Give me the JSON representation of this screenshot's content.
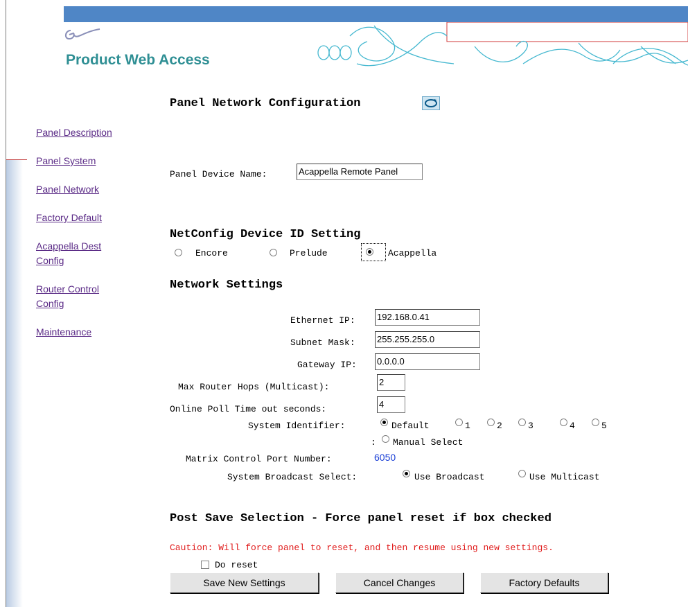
{
  "brand": {
    "title": "Product Web Access"
  },
  "nav": {
    "items": [
      {
        "label": "Panel Description"
      },
      {
        "label": "Panel System"
      },
      {
        "label": "Panel Network"
      },
      {
        "label": "Factory Default"
      },
      {
        "label": "Acappella Dest",
        "label2": "Config"
      },
      {
        "label": "Router Control",
        "label2": "Config"
      },
      {
        "label": "Maintenance"
      }
    ]
  },
  "page": {
    "title": "Panel Network Configuration",
    "device_name_label": "Panel Device Name:",
    "device_name_value": "Acappella Remote Panel"
  },
  "netconfig": {
    "heading": "NetConfig Device ID Setting",
    "options": [
      "Encore",
      "Prelude",
      "Acappella"
    ],
    "selected": "Acappella"
  },
  "network": {
    "heading": "Network Settings",
    "ethernet_ip_label": "Ethernet IP:",
    "ethernet_ip": "192.168.0.41",
    "subnet_label": "Subnet Mask:",
    "subnet": "255.255.255.0",
    "gateway_label": "Gateway IP:",
    "gateway": "0.0.0.0",
    "hops_label": "Max Router Hops (Multicast):",
    "hops": "2",
    "poll_label": "Online Poll Time out seconds:",
    "poll": "4",
    "sysid_label": "System Identifier:",
    "sysid_options": [
      "Default",
      "1",
      "2",
      "3",
      "4",
      "5"
    ],
    "sysid_selected": "Default",
    "manual_prefix": ":",
    "manual_label": "Manual Select",
    "port_label": "Matrix Control Port Number:",
    "port_value": "6050",
    "broadcast_label": "System Broadcast Select:",
    "broadcast_options": [
      "Use Broadcast",
      "Use Multicast"
    ],
    "broadcast_selected": "Use Broadcast"
  },
  "post_save": {
    "heading": "Post Save Selection - Force panel reset if box checked",
    "caution": "Caution: Will force panel to reset, and then resume using new settings.",
    "reset_label": "Do reset"
  },
  "buttons": {
    "save": "Save New Settings",
    "cancel": "Cancel Changes",
    "factory": "Factory Defaults"
  },
  "colors": {
    "topbar": "#4f86c6",
    "brand": "#2f8f94",
    "link": "#5a2a86",
    "caution": "#e01a1a"
  }
}
